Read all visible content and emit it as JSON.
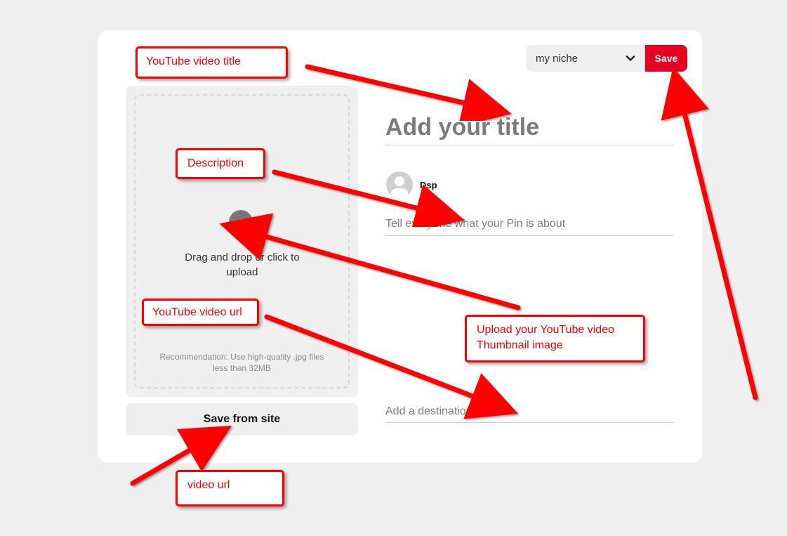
{
  "header": {
    "board_select": {
      "value": "my niche"
    },
    "save_label": "Save"
  },
  "main": {
    "title_placeholder": "Add your title",
    "user": {
      "name": "Dsp"
    },
    "description_placeholder": "Tell everyone what your Pin is about",
    "destination_placeholder": "Add a destination link"
  },
  "upload": {
    "text_line1": "Drag and drop or click to",
    "text_line2": "upload",
    "recommendation_line1": "Recommendation: Use high-quality .jpg files",
    "recommendation_line2": "less than 32MB",
    "save_from_site_label": "Save from site"
  },
  "annotations": {
    "title": "YouTube video title",
    "description": "Description",
    "youtube_url": "YouTube video url",
    "thumbnail_line1": "Upload your YouTube video",
    "thumbnail_line2": "Thumbnail image",
    "video_url": "video url"
  },
  "icons": {
    "chevron": "chevron-down-icon",
    "upload": "upload-arrow-icon",
    "avatar": "user-avatar-icon"
  },
  "colors": {
    "page_bg": "#efefef",
    "card_bg": "#ffffff",
    "accent_red": "#e60023",
    "annotation_red": "#ff0000",
    "upload_bg": "#efefef"
  }
}
